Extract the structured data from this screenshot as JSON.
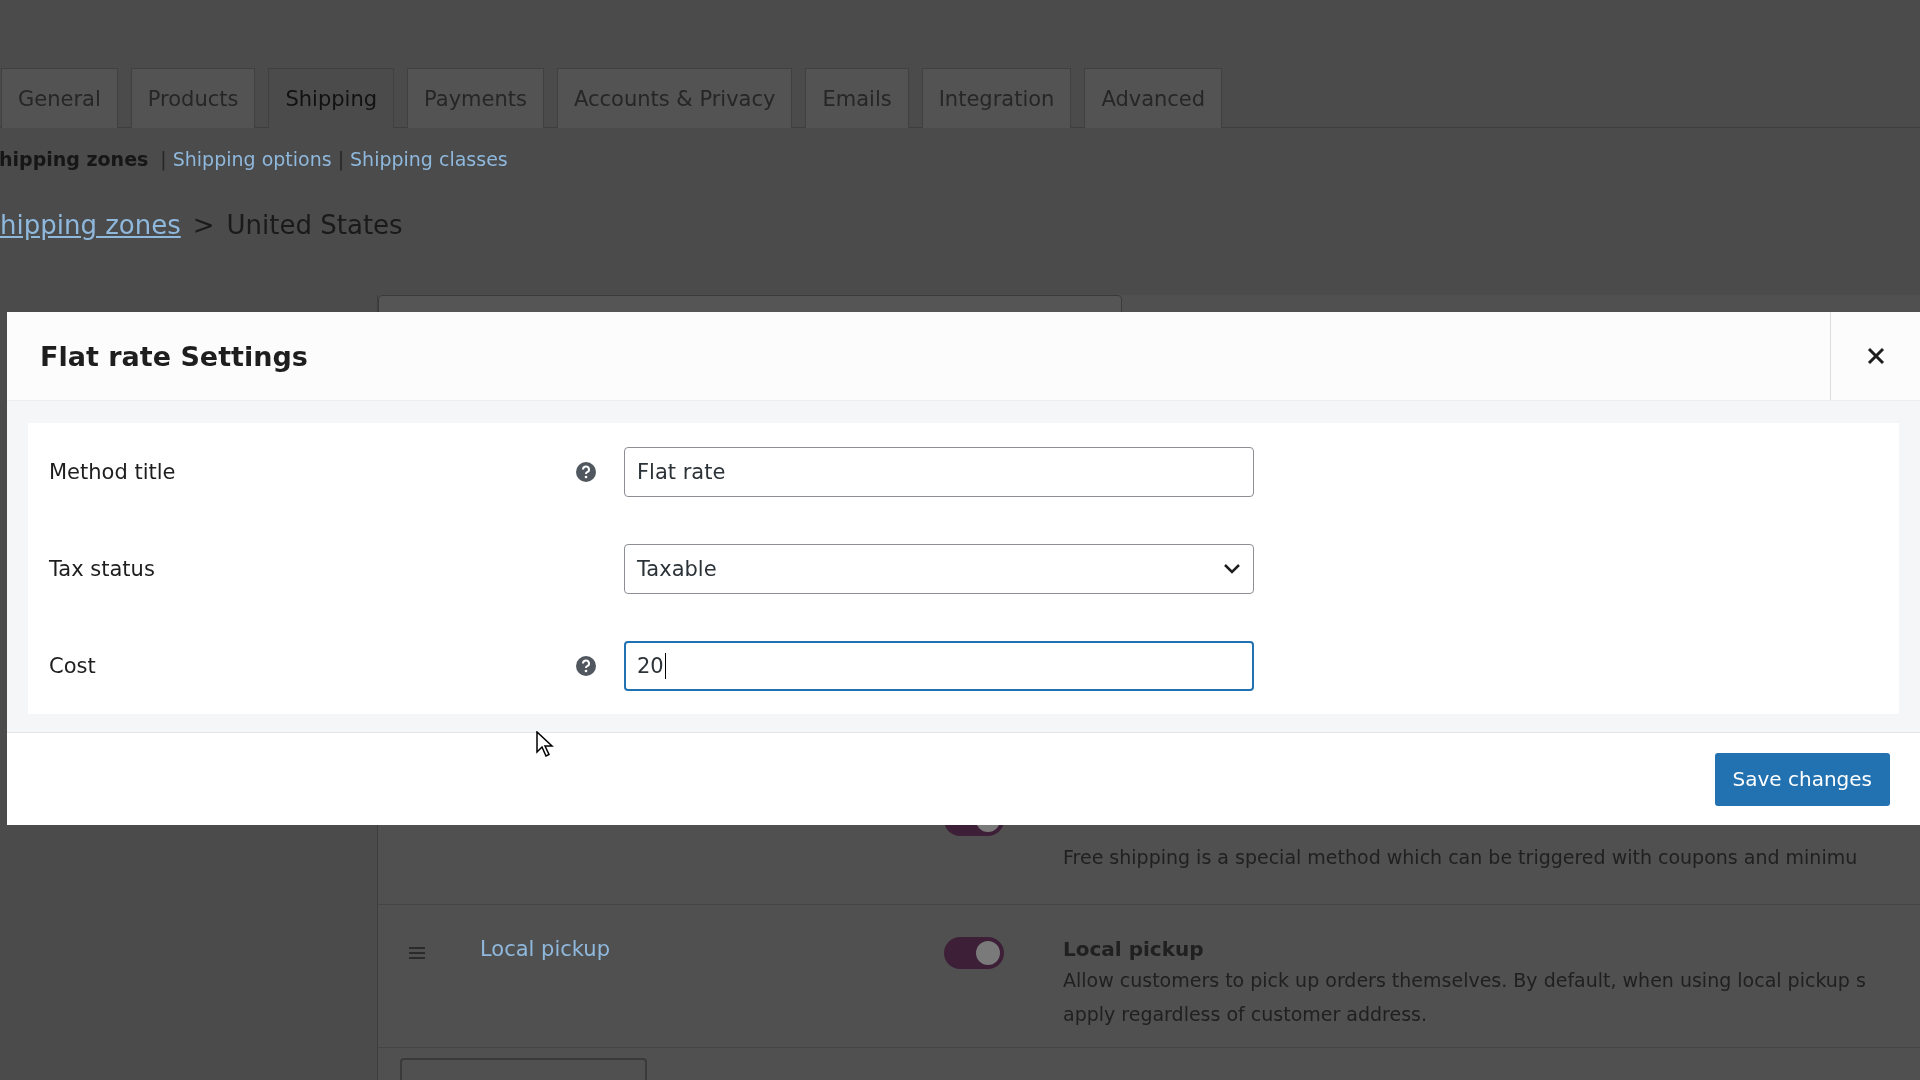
{
  "tabs": [
    {
      "label": "General",
      "selected": false
    },
    {
      "label": "Products",
      "selected": false
    },
    {
      "label": "Shipping",
      "selected": true
    },
    {
      "label": "Payments",
      "selected": false
    },
    {
      "label": "Accounts & Privacy",
      "selected": false
    },
    {
      "label": "Emails",
      "selected": false
    },
    {
      "label": "Integration",
      "selected": false
    },
    {
      "label": "Advanced",
      "selected": false
    }
  ],
  "subnav": [
    {
      "label": "hipping zones",
      "current": true
    },
    {
      "separator": "|",
      "label": "Shipping options",
      "current": false
    },
    {
      "separator": "|",
      "label": "Shipping classes",
      "current": false
    }
  ],
  "breadcrumb": {
    "link": "hipping zones",
    "separator": ">",
    "current": "United States"
  },
  "methods": [
    {
      "on": true,
      "description": [
        "Free shipping is a special method which can be triggered with coupons and minimu"
      ]
    },
    {
      "on": true,
      "name": "Local pickup",
      "title": "Local pickup",
      "description": [
        "Allow customers to pick up orders themselves. By default, when using local pickup s",
        "apply regardless of customer address."
      ]
    }
  ],
  "modal": {
    "title": "Flat rate Settings",
    "fields": [
      {
        "label": "Method title",
        "kind": "text",
        "help": true,
        "value": "Flat rate",
        "focused": false
      },
      {
        "label": "Tax status",
        "kind": "select",
        "help": false,
        "value": "Taxable",
        "focused": false
      },
      {
        "label": "Cost",
        "kind": "text",
        "help": true,
        "value": "20",
        "focused": true
      }
    ],
    "save_button": "Save changes"
  }
}
